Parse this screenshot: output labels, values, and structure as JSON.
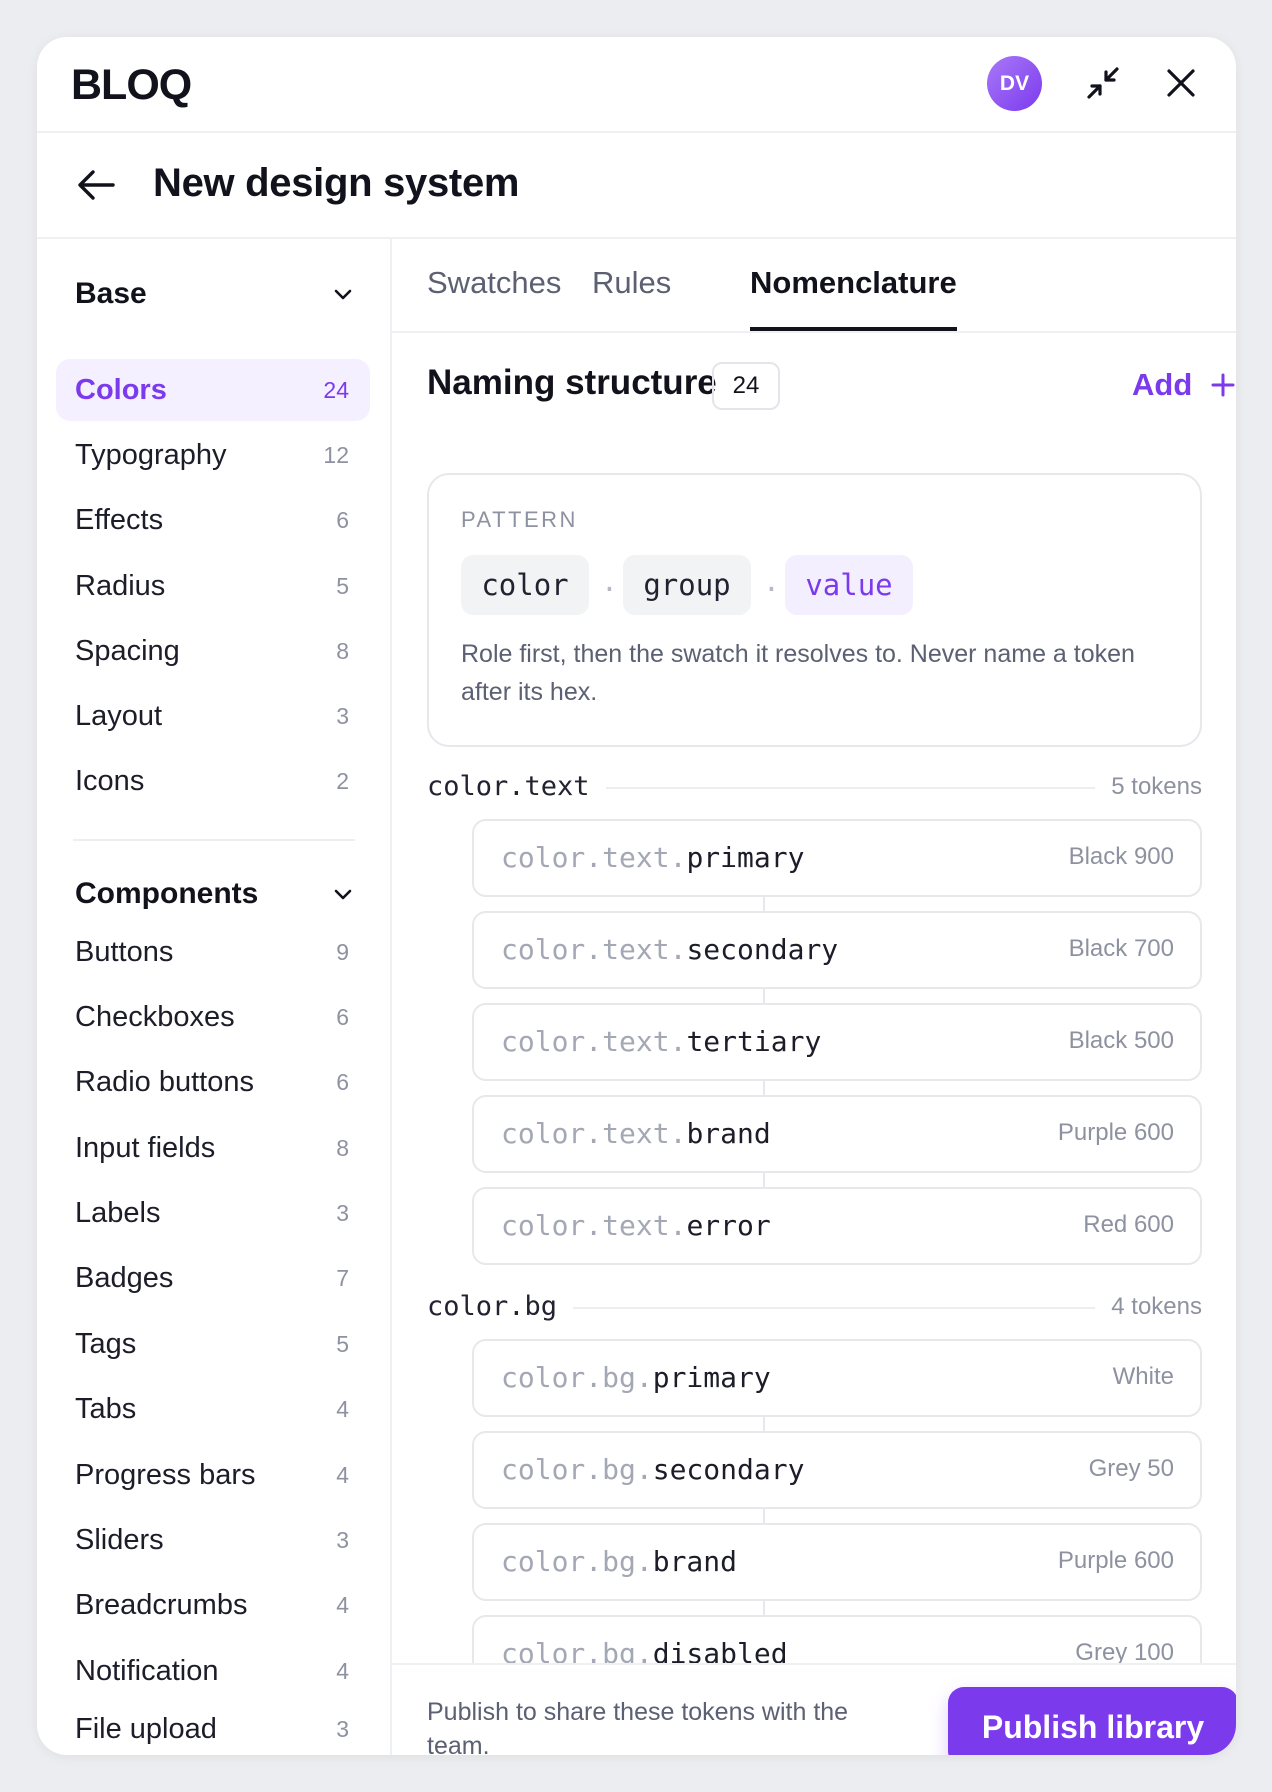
{
  "app": {
    "logo": "BLOQ",
    "avatar_initials": "DV"
  },
  "header": {
    "title": "New design system"
  },
  "sidebar": {
    "sections": [
      {
        "label": "Base",
        "items": [
          {
            "name": "Colors",
            "count": "24",
            "active": true
          },
          {
            "name": "Typography",
            "count": "12"
          },
          {
            "name": "Effects",
            "count": "6"
          },
          {
            "name": "Radius",
            "count": "5"
          },
          {
            "name": "Spacing",
            "count": "8"
          },
          {
            "name": "Layout",
            "count": "3"
          },
          {
            "name": "Icons",
            "count": "2"
          }
        ]
      },
      {
        "label": "Components",
        "items": [
          {
            "name": "Buttons",
            "count": "9"
          },
          {
            "name": "Checkboxes",
            "count": "6"
          },
          {
            "name": "Radio buttons",
            "count": "6"
          },
          {
            "name": "Input fields",
            "count": "8"
          },
          {
            "name": "Labels",
            "count": "3"
          },
          {
            "name": "Badges",
            "count": "7"
          },
          {
            "name": "Tags",
            "count": "5"
          },
          {
            "name": "Tabs",
            "count": "4"
          },
          {
            "name": "Progress bars",
            "count": "4"
          },
          {
            "name": "Sliders",
            "count": "3"
          },
          {
            "name": "Breadcrumbs",
            "count": "4"
          },
          {
            "name": "Notification",
            "count": "4"
          },
          {
            "name": "File upload",
            "count": "3"
          }
        ]
      }
    ]
  },
  "tabs": [
    {
      "label": "Swatches"
    },
    {
      "label": "Rules"
    },
    {
      "label": "Nomenclature",
      "active": true
    }
  ],
  "naming": {
    "title": "Naming structure",
    "count": "24",
    "add_label": "Add",
    "pattern_label": "PATTERN",
    "pattern_parts": [
      "color",
      "group",
      "value"
    ],
    "separator": ".",
    "description": "Role first, then the swatch it resolves to. Never name a token after its hex."
  },
  "groups": [
    {
      "name": "color.text",
      "count": "5 tokens",
      "tokens": [
        {
          "prefix": "color.text.",
          "suffix": "primary",
          "value": "Black 900"
        },
        {
          "prefix": "color.text.",
          "suffix": "secondary",
          "value": "Black 700"
        },
        {
          "prefix": "color.text.",
          "suffix": "tertiary",
          "value": "Black 500"
        },
        {
          "prefix": "color.text.",
          "suffix": "brand",
          "value": "Purple 600"
        },
        {
          "prefix": "color.text.",
          "suffix": "error",
          "value": "Red 600"
        }
      ]
    },
    {
      "name": "color.bg",
      "count": "4 tokens",
      "tokens": [
        {
          "prefix": "color.bg.",
          "suffix": "primary",
          "value": "White"
        },
        {
          "prefix": "color.bg.",
          "suffix": "secondary",
          "value": "Grey 50"
        },
        {
          "prefix": "color.bg.",
          "suffix": "brand",
          "value": "Purple 600"
        },
        {
          "prefix": "color.bg.",
          "suffix": "disabled",
          "value": "Grey 100"
        }
      ]
    }
  ],
  "footer": {
    "text": "Publish to share these tokens with the team.",
    "publish_label": "Publish library"
  },
  "colors": {
    "accent": "#7c3aed",
    "accent_soft": "#f4f0ff",
    "text": "#12121c",
    "muted": "#8e92a0"
  }
}
